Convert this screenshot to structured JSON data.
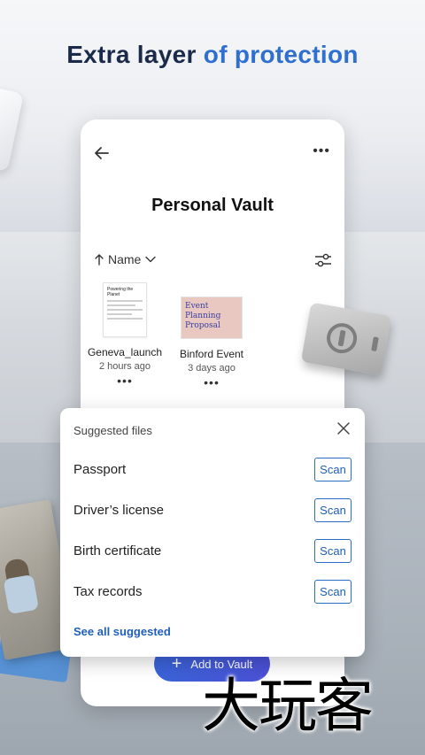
{
  "headline": {
    "part1": "Extra layer",
    "part2": "of protection"
  },
  "vault": {
    "title": "Personal Vault",
    "sort_label": "Name",
    "files": [
      {
        "name": "Geneva_launch",
        "time": "2 hours ago",
        "thumb_title": "Powering the Planet",
        "more": "•••"
      },
      {
        "name": "Binford Event",
        "time": "3 days ago",
        "thumb_title": "Event Planning Proposal",
        "more": "•••"
      }
    ],
    "add_button": "Add to Vault",
    "more": "•••"
  },
  "suggested": {
    "title": "Suggested files",
    "items": [
      {
        "label": "Passport",
        "action": "Scan"
      },
      {
        "label": "Driver’s license",
        "action": "Scan"
      },
      {
        "label": "Birth certificate",
        "action": "Scan"
      },
      {
        "label": "Tax records",
        "action": "Scan"
      }
    ],
    "see_all": "See all suggested"
  },
  "watermark": "大玩客",
  "colors": {
    "accent": "#2f6fd0",
    "link": "#1f5fb8",
    "button": "#3a64d8",
    "title": "#1b2a4a"
  }
}
